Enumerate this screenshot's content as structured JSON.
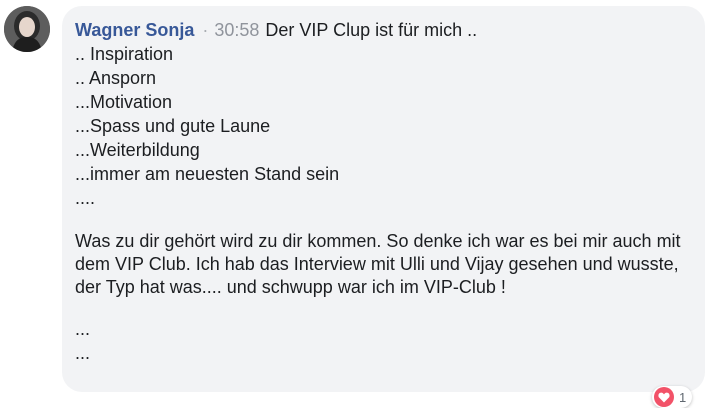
{
  "comment": {
    "author": "Wagner Sonja",
    "separator": "·",
    "time": "30:58",
    "lines": [
      "Der VIP Clup ist für mich ..",
      ".. Inspiration",
      ".. Ansporn",
      "...Motivation",
      "...Spass und gute Laune",
      "...Weiterbildung",
      "...immer am neuesten Stand sein",
      "...."
    ],
    "paragraph": "Was zu dir gehört wird zu dir kommen. So denke ich war es bei mir auch mit dem VIP Club. Ich hab das Interview mit Ulli und Vijay gesehen und wusste, der Typ hat was.... und schwupp war ich im VIP-Club !",
    "trailing": [
      "...",
      "..."
    ]
  },
  "reactions": {
    "icon": "heart-icon",
    "count": "1"
  },
  "colors": {
    "author": "#385898",
    "bubble": "#f2f3f5",
    "heart": "#f25268"
  }
}
